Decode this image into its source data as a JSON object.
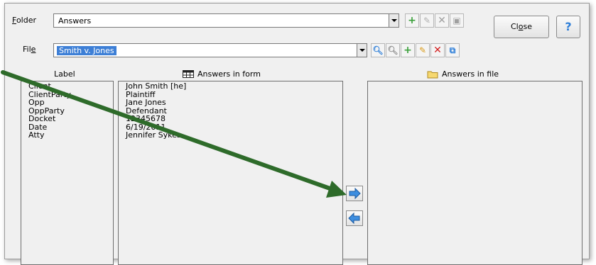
{
  "folder": {
    "label": "Folder",
    "accel": "F",
    "rest": "older",
    "value": "Answers"
  },
  "file": {
    "label_pre": "Fil",
    "accel": "e",
    "value": "Smith v. Jones"
  },
  "buttons": {
    "close_pre": "Cl",
    "close_accel": "o",
    "close_post": "se",
    "help": "?"
  },
  "columns": {
    "label": "Label",
    "answers_in_form": "Answers in form",
    "answers_in_file": "Answers in file"
  },
  "labels": [
    "Client",
    "ClientParty",
    "Opp",
    "OppParty",
    "Docket",
    "Date",
    "Atty"
  ],
  "form_values": [
    "John Smith [he]",
    "Plaintiff",
    "Jane Jones",
    "Defendant",
    "12345678",
    "6/19/2011",
    "Jennifer Sykes"
  ],
  "file_values": [],
  "colors": {
    "accent_blue": "#2f7fd8",
    "add_green": "#3aa03a",
    "delete_red": "#d42020",
    "annotation_arrow": "#2e6b2a"
  }
}
